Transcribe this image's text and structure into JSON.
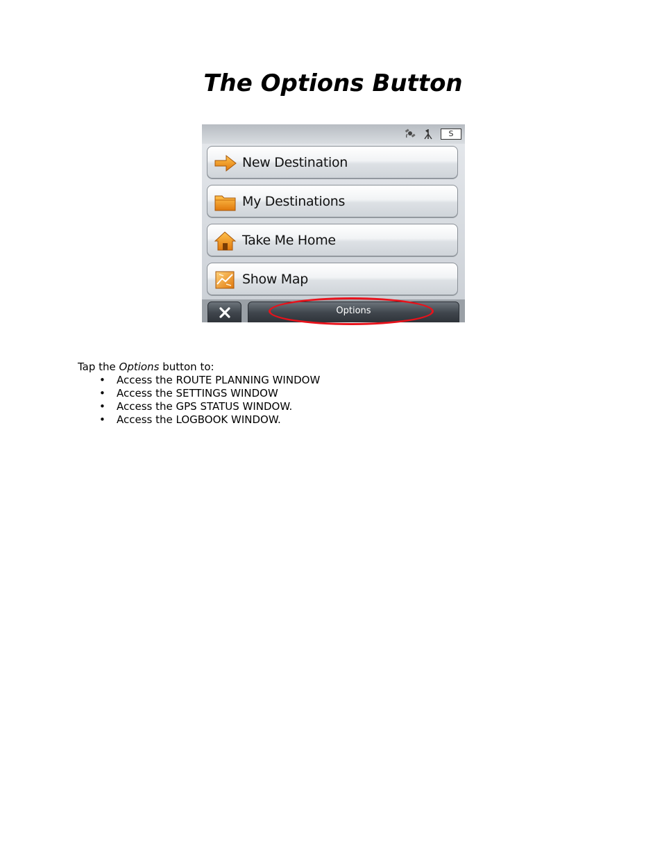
{
  "page": {
    "title": "The Options Button"
  },
  "device": {
    "status": {
      "icons": [
        "satellite-icon",
        "antenna-icon"
      ],
      "indicator": "S"
    },
    "menu": [
      {
        "label": "New Destination",
        "icon": "arrow-right-icon",
        "color": "#f5a623"
      },
      {
        "label": "My Destinations",
        "icon": "folder-icon",
        "color": "#f5a623"
      },
      {
        "label": "Take Me Home",
        "icon": "house-icon",
        "color": "#f5a623"
      },
      {
        "label": "Show Map",
        "icon": "map-icon",
        "color": "#f5a623"
      }
    ],
    "bottom_bar": {
      "close_icon": "close-icon",
      "options_label": "Options"
    },
    "highlight_color": "#e8121b"
  },
  "body": {
    "intro_before": "Tap the ",
    "intro_emphasis": "Options",
    "intro_after": " button to:",
    "bullets": [
      "Access the ROUTE PLANNING WINDOW",
      "Access the SETTINGS WINDOW",
      "Access the GPS STATUS WINDOW.",
      "Access the LOGBOOK WINDOW."
    ]
  }
}
